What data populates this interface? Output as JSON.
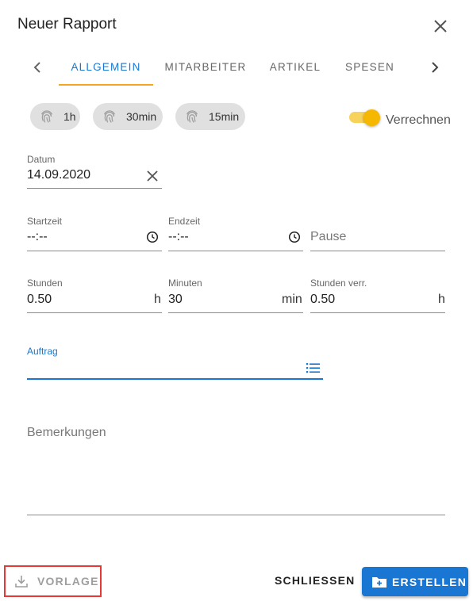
{
  "dialog": {
    "title": "Neuer Rapport"
  },
  "tabs": [
    {
      "label": "Allgemein",
      "active": true
    },
    {
      "label": "Mitarbeiter",
      "active": false
    },
    {
      "label": "Artikel",
      "active": false
    },
    {
      "label": "Spesen",
      "active": false
    }
  ],
  "chips": [
    {
      "label": "1h",
      "icon": "fingerprint-icon"
    },
    {
      "label": "30min",
      "icon": "fingerprint-icon"
    },
    {
      "label": "15min",
      "icon": "fingerprint-icon"
    }
  ],
  "verrechnen": {
    "label": "Verrechnen",
    "checked": true
  },
  "fields": {
    "datum": {
      "label": "Datum",
      "value": "14.09.2020"
    },
    "startzeit": {
      "label": "Startzeit",
      "value": "--:--"
    },
    "endzeit": {
      "label": "Endzeit",
      "value": "--:--"
    },
    "pause": {
      "placeholder": "Pause"
    },
    "stunden": {
      "label": "Stunden",
      "value": "0.50",
      "suffix": "h"
    },
    "minuten": {
      "label": "Minuten",
      "value": "30",
      "suffix": "min"
    },
    "stunden_verr": {
      "label": "Stunden verr.",
      "value": "0.50",
      "suffix": "h"
    },
    "auftrag": {
      "label": "Auftrag",
      "value": ""
    },
    "bemerkungen": {
      "placeholder": "Bemerkungen"
    }
  },
  "footer": {
    "vorlage": "VORLAGE",
    "schliessen": "SCHLIESSEN",
    "erstellen": "ERSTELLEN"
  },
  "colors": {
    "primary": "#1976d2",
    "accent": "#f5b700",
    "highlight_border": "#e53935"
  }
}
